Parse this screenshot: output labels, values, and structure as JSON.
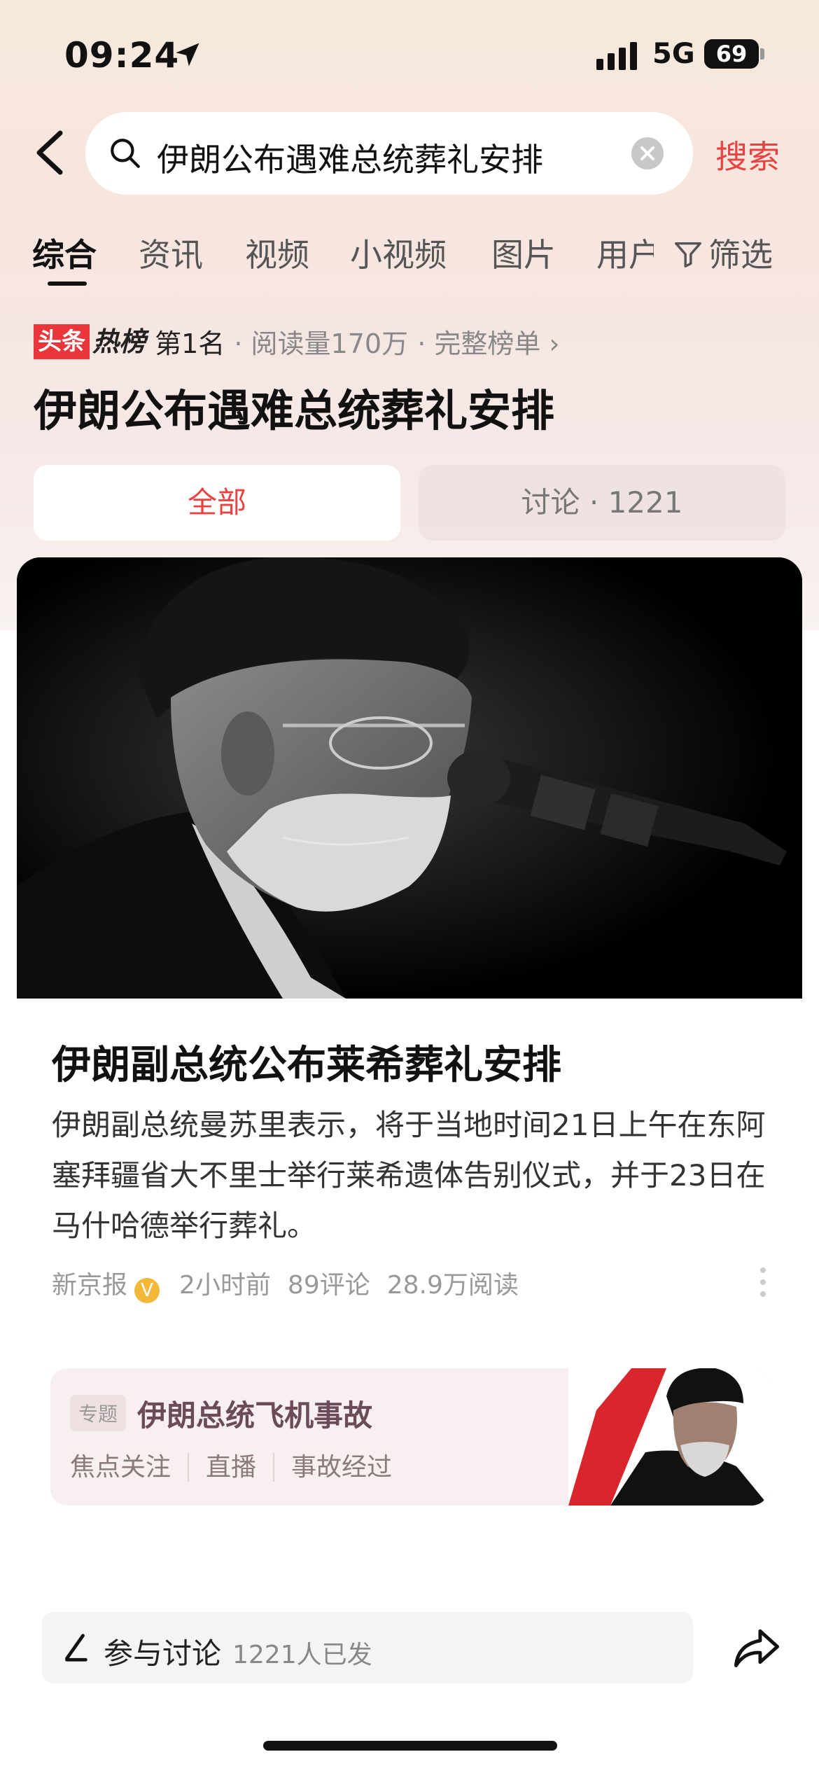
{
  "status_bar": {
    "time": "09:24",
    "network": "5G",
    "battery": "69"
  },
  "search": {
    "query": "伊朗公布遇难总统葬礼安排",
    "button": "搜索"
  },
  "tabs": [
    "综合",
    "资讯",
    "视频",
    "小视频",
    "图片",
    "用户"
  ],
  "filter_label": "筛选",
  "hot_list": {
    "logo_part1": "头条",
    "logo_part2": "热榜",
    "rank": "第1名",
    "reads": "· 阅读量170万",
    "full_list": "· 完整榜单 ›"
  },
  "topic_title": "伊朗公布遇难总统葬礼安排",
  "segments": {
    "all": "全部",
    "discussion": "讨论 · 1221"
  },
  "article": {
    "title": "伊朗副总统公布莱希葬礼安排",
    "summary": "伊朗副总统曼苏里表示，将于当地时间21日上午在东阿塞拜疆省大不里士举行莱希遗体告别仪式，并于23日在马什哈德举行葬礼。",
    "source": "新京报",
    "verified_mark": "V",
    "time": "2小时前",
    "comments": "89评论",
    "reads": "28.9万阅读"
  },
  "special_topic": {
    "tag": "专题",
    "title": "伊朗总统飞机事故",
    "links": [
      "焦点关注",
      "直播",
      "事故经过"
    ]
  },
  "bottom": {
    "discuss_label": "参与讨论",
    "discuss_count": "1221人已发"
  },
  "colors": {
    "accent": "#e84343",
    "hot_red": "#e8363b",
    "verified": "#f3b73a"
  },
  "icons": [
    "location-arrow-icon",
    "signal-icon",
    "battery-icon",
    "back-arrow-icon",
    "search-icon",
    "clear-icon",
    "filter-icon",
    "verified-icon",
    "more-icon",
    "pen-icon",
    "share-icon"
  ]
}
